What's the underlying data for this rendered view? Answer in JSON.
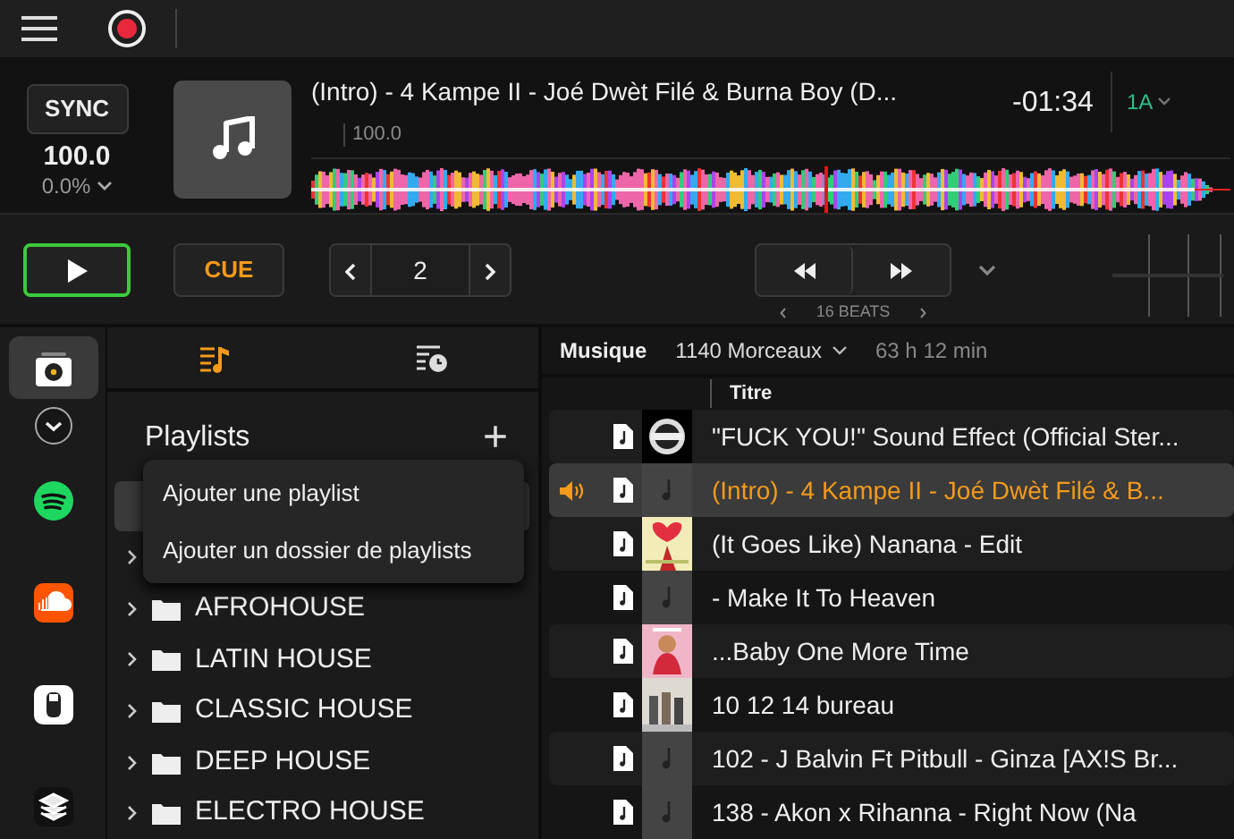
{
  "deck": {
    "sync": "SYNC",
    "bpm": "100.0",
    "pitch": "0.0%",
    "title": "(Intro) - 4 Kampe II - Joé Dwèt Filé & Burna Boy (D...",
    "bpm_marker": "100.0",
    "time": "-01:34",
    "key": "1A"
  },
  "transport": {
    "cue": "CUE",
    "loop": "2",
    "beats": "16 BEATS",
    "playing": false
  },
  "sources": [
    {
      "kind": "library",
      "selected": true
    },
    {
      "kind": "more",
      "selected": false
    },
    {
      "kind": "spotify",
      "selected": false
    },
    {
      "kind": "soundcloud",
      "selected": false
    },
    {
      "kind": "usb",
      "selected": false
    },
    {
      "kind": "layers",
      "selected": false
    }
  ],
  "panel_tabs": [
    {
      "kind": "playlists",
      "selected": true
    },
    {
      "kind": "history",
      "selected": false
    }
  ],
  "playlists": {
    "title": "Playlists",
    "add": "+",
    "menu": [
      "Ajouter une playlist",
      "Ajouter un dossier de playlists"
    ],
    "items": [
      {
        "expanded": false
      },
      {
        "label": "AFROHOUSE",
        "expanded": false
      },
      {
        "label": "LATIN HOUSE",
        "expanded": false
      },
      {
        "label": "CLASSIC HOUSE",
        "expanded": false
      },
      {
        "label": "DEEP HOUSE",
        "expanded": false
      },
      {
        "label": "ELECTRO HOUSE",
        "expanded": false
      }
    ]
  },
  "tracklist": {
    "source": "Musique",
    "count": "1140 Morceaux",
    "duration": "63 h 12 min",
    "columns": [
      "Titre"
    ],
    "rows": [
      {
        "title": "\"FUCK YOU!\" Sound Effect (Official Ster...",
        "kind": "picture",
        "selected": false
      },
      {
        "title": "(Intro) - 4 Kampe II - Joé Dwèt Filé & B...",
        "kind": "placeholder",
        "selected": true
      },
      {
        "title": "(It Goes Like) Nanana - Edit",
        "kind": "picture",
        "selected": false
      },
      {
        "title": "- Make It To Heaven",
        "kind": "placeholder",
        "selected": false
      },
      {
        "title": "...Baby One More Time",
        "kind": "picture",
        "selected": false
      },
      {
        "title": "10 12 14 bureau",
        "kind": "picture",
        "selected": false
      },
      {
        "title": "102 - J Balvin Ft Pitbull - Ginza [AX!S Br...",
        "kind": "placeholder",
        "selected": false
      },
      {
        "title": "138 - Akon x Rihanna - Right Now (Na",
        "kind": "placeholder",
        "selected": false
      }
    ]
  }
}
